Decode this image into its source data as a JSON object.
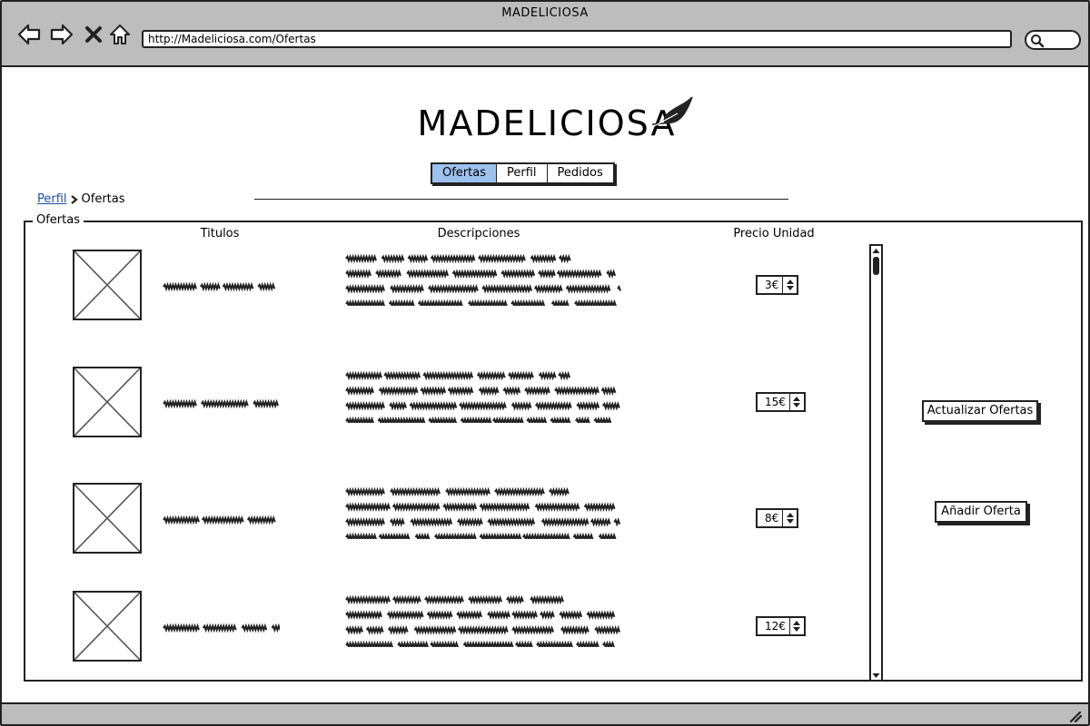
{
  "window": {
    "title": "MADELICIOSA",
    "url": "http://Madeliciosa.com/Ofertas"
  },
  "header": {
    "logo": "MADELICIOSA",
    "logo_icon": "feather-icon"
  },
  "tabs": [
    {
      "label": "Ofertas",
      "active": true
    },
    {
      "label": "Perfil",
      "active": false
    },
    {
      "label": "Pedidos",
      "active": false
    }
  ],
  "breadcrumb": {
    "parent": "Perfil",
    "current": "Ofertas"
  },
  "offers": {
    "legend": "Ofertas",
    "columns": {
      "title": "Titulos",
      "description": "Descripciones",
      "price": "Precio Unidad"
    },
    "rows": [
      {
        "price": "3€"
      },
      {
        "price": "15€"
      },
      {
        "price": "8€"
      },
      {
        "price": "12€"
      }
    ]
  },
  "actions": {
    "update": "Actualizar Ofertas",
    "add": "Añadir Oferta"
  },
  "colors": {
    "chrome": "#bdbdbd",
    "active_tab": "#9dc1ee",
    "link": "#1f4fa8"
  }
}
